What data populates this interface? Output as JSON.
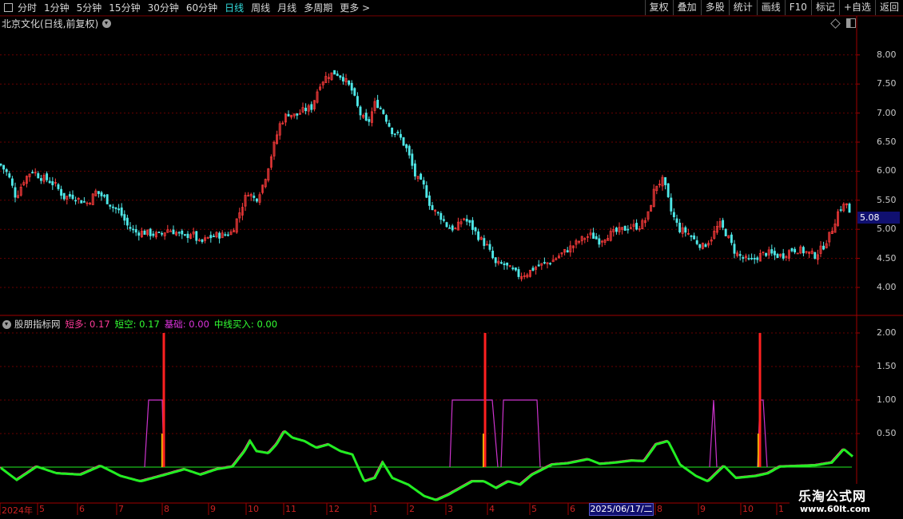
{
  "toolbar": {
    "periods": [
      "分时",
      "1分钟",
      "5分钟",
      "15分钟",
      "30分钟",
      "60分钟",
      "日线",
      "周线",
      "月线",
      "多周期"
    ],
    "active_period": "日线",
    "more": "更多 >",
    "right_buttons": [
      "复权",
      "叠加",
      "多股",
      "统计",
      "画线",
      "F10",
      "标记",
      "+自选",
      "返回"
    ]
  },
  "stock_title": "北京文化(日线,前复权)",
  "current_price": "5.08",
  "indicator": {
    "name": "股朋指标网",
    "items": [
      {
        "label": "短多: 0.17",
        "color": "#ff3b9a"
      },
      {
        "label": "短空: 0.17",
        "color": "#33ff33"
      },
      {
        "label": "基础: 0.00",
        "color": "#dd33dd"
      },
      {
        "label": "中线买入: 0.00",
        "color": "#33ff33"
      }
    ]
  },
  "colors": {
    "up": "#ff3c3c",
    "down": "#4fe8e8",
    "grid": "#6a0000",
    "axis": "#a00000",
    "green": "#22ee22",
    "magenta": "#cc33cc",
    "bar": "#ff2020"
  },
  "date_axis": {
    "labels": [
      {
        "text": "2024年",
        "x": 2
      },
      {
        "text": "5",
        "x": 49
      },
      {
        "text": "6",
        "x": 99
      },
      {
        "text": "7",
        "x": 148
      },
      {
        "text": "8",
        "x": 205
      },
      {
        "text": "9",
        "x": 263
      },
      {
        "text": "10",
        "x": 310
      },
      {
        "text": "11",
        "x": 357
      },
      {
        "text": "12",
        "x": 411
      },
      {
        "text": "1",
        "x": 466
      },
      {
        "text": "2",
        "x": 512
      },
      {
        "text": "3",
        "x": 560
      },
      {
        "text": "4",
        "x": 612
      },
      {
        "text": "5",
        "x": 665
      },
      {
        "text": "6",
        "x": 713
      },
      {
        "text": "8",
        "x": 822
      },
      {
        "text": "9",
        "x": 876
      },
      {
        "text": "10",
        "x": 929
      },
      {
        "text": "1",
        "x": 974
      }
    ],
    "highlight": "2025/06/17/二"
  },
  "chart_data": [
    {
      "type": "candlestick",
      "title": "北京文化(日线,前复权)",
      "y_ticks": [
        4.0,
        4.5,
        5.0,
        5.5,
        6.0,
        6.5,
        7.0,
        7.5,
        8.0
      ],
      "ylim": [
        3.7,
        8.5
      ],
      "close_path": [
        [
          0,
          6.12
        ],
        [
          10,
          5.95
        ],
        [
          20,
          5.55
        ],
        [
          30,
          5.85
        ],
        [
          40,
          6.02
        ],
        [
          50,
          5.9
        ],
        [
          60,
          5.85
        ],
        [
          70,
          5.75
        ],
        [
          80,
          5.55
        ],
        [
          90,
          5.58
        ],
        [
          100,
          5.5
        ],
        [
          110,
          5.45
        ],
        [
          120,
          5.65
        ],
        [
          130,
          5.55
        ],
        [
          140,
          5.4
        ],
        [
          150,
          5.3
        ],
        [
          160,
          5.05
        ],
        [
          170,
          4.95
        ],
        [
          180,
          4.95
        ],
        [
          190,
          4.92
        ],
        [
          200,
          4.9
        ],
        [
          210,
          5.0
        ],
        [
          220,
          4.95
        ],
        [
          230,
          4.85
        ],
        [
          240,
          4.95
        ],
        [
          250,
          4.75
        ],
        [
          260,
          4.85
        ],
        [
          270,
          4.9
        ],
        [
          280,
          4.9
        ],
        [
          290,
          4.95
        ],
        [
          300,
          5.3
        ],
        [
          310,
          5.65
        ],
        [
          320,
          5.5
        ],
        [
          330,
          5.8
        ],
        [
          340,
          6.3
        ],
        [
          350,
          6.8
        ],
        [
          360,
          7.0
        ],
        [
          370,
          6.95
        ],
        [
          380,
          7.05
        ],
        [
          390,
          7.1
        ],
        [
          400,
          7.5
        ],
        [
          410,
          7.65
        ],
        [
          420,
          7.7
        ],
        [
          430,
          7.6
        ],
        [
          440,
          7.4
        ],
        [
          450,
          7.0
        ],
        [
          460,
          6.8
        ],
        [
          470,
          7.2
        ],
        [
          480,
          7.0
        ],
        [
          490,
          6.7
        ],
        [
          500,
          6.6
        ],
        [
          510,
          6.35
        ],
        [
          520,
          5.9
        ],
        [
          530,
          5.75
        ],
        [
          540,
          5.35
        ],
        [
          550,
          5.25
        ],
        [
          560,
          5.05
        ],
        [
          570,
          5.0
        ],
        [
          580,
          5.2
        ],
        [
          590,
          5.05
        ],
        [
          600,
          4.85
        ],
        [
          610,
          4.7
        ],
        [
          620,
          4.4
        ],
        [
          630,
          4.4
        ],
        [
          640,
          4.3
        ],
        [
          650,
          4.2
        ],
        [
          660,
          4.25
        ],
        [
          670,
          4.35
        ],
        [
          680,
          4.4
        ],
        [
          690,
          4.45
        ],
        [
          700,
          4.55
        ],
        [
          710,
          4.65
        ],
        [
          720,
          4.75
        ],
        [
          730,
          4.85
        ],
        [
          740,
          4.9
        ],
        [
          750,
          4.8
        ],
        [
          760,
          4.9
        ],
        [
          770,
          4.95
        ],
        [
          780,
          5.0
        ],
        [
          790,
          5.05
        ],
        [
          800,
          5.05
        ],
        [
          810,
          5.2
        ],
        [
          820,
          5.75
        ],
        [
          830,
          5.85
        ],
        [
          840,
          5.3
        ],
        [
          850,
          5.0
        ],
        [
          860,
          4.95
        ],
        [
          870,
          4.8
        ],
        [
          880,
          4.7
        ],
        [
          890,
          4.85
        ],
        [
          900,
          5.1
        ],
        [
          910,
          4.9
        ],
        [
          920,
          4.6
        ],
        [
          930,
          4.5
        ],
        [
          940,
          4.45
        ],
        [
          950,
          4.55
        ],
        [
          960,
          4.6
        ],
        [
          970,
          4.55
        ],
        [
          980,
          4.55
        ],
        [
          990,
          4.65
        ],
        [
          1000,
          4.65
        ],
        [
          1010,
          4.6
        ],
        [
          1020,
          4.55
        ],
        [
          1030,
          4.7
        ],
        [
          1040,
          4.95
        ],
        [
          1050,
          5.35
        ],
        [
          1060,
          5.45
        ],
        [
          1066,
          5.08
        ]
      ]
    },
    {
      "type": "line",
      "title": "股朋指标网",
      "y_ticks": [
        0.5,
        1.0,
        1.5,
        2.0
      ],
      "ylim": [
        -0.5,
        2.2
      ],
      "series": [
        {
          "name": "短空",
          "values": [
            [
              0,
              0.0
            ],
            [
              20,
              -0.18
            ],
            [
              45,
              0.02
            ],
            [
              70,
              -0.08
            ],
            [
              100,
              -0.1
            ],
            [
              125,
              0.03
            ],
            [
              150,
              -0.12
            ],
            [
              175,
              -0.2
            ],
            [
              200,
              -0.12
            ],
            [
              230,
              -0.02
            ],
            [
              250,
              -0.1
            ],
            [
              270,
              -0.02
            ],
            [
              290,
              0.02
            ],
            [
              305,
              0.25
            ],
            [
              312,
              0.4
            ],
            [
              320,
              0.25
            ],
            [
              335,
              0.22
            ],
            [
              345,
              0.35
            ],
            [
              355,
              0.55
            ],
            [
              365,
              0.45
            ],
            [
              380,
              0.4
            ],
            [
              395,
              0.3
            ],
            [
              410,
              0.35
            ],
            [
              425,
              0.25
            ],
            [
              440,
              0.2
            ],
            [
              455,
              -0.2
            ],
            [
              468,
              -0.15
            ],
            [
              478,
              0.08
            ],
            [
              490,
              -0.15
            ],
            [
              510,
              -0.25
            ],
            [
              530,
              -0.42
            ],
            [
              545,
              -0.48
            ],
            [
              560,
              -0.4
            ],
            [
              575,
              -0.3
            ],
            [
              590,
              -0.2
            ],
            [
              605,
              -0.2
            ],
            [
              620,
              -0.3
            ],
            [
              635,
              -0.2
            ],
            [
              650,
              -0.25
            ],
            [
              665,
              -0.1
            ],
            [
              690,
              0.05
            ],
            [
              710,
              0.07
            ],
            [
              735,
              0.13
            ],
            [
              750,
              0.06
            ],
            [
              770,
              0.08
            ],
            [
              790,
              0.11
            ],
            [
              805,
              0.1
            ],
            [
              820,
              0.35
            ],
            [
              835,
              0.4
            ],
            [
              850,
              0.05
            ],
            [
              870,
              -0.12
            ],
            [
              885,
              -0.2
            ],
            [
              905,
              0.03
            ],
            [
              920,
              -0.15
            ],
            [
              945,
              -0.12
            ],
            [
              960,
              -0.08
            ],
            [
              975,
              0.02
            ],
            [
              1000,
              0.03
            ],
            [
              1020,
              0.04
            ],
            [
              1040,
              0.08
            ],
            [
              1055,
              0.28
            ],
            [
              1066,
              0.17
            ]
          ]
        },
        {
          "name": "中线买入",
          "values": [
            [
              0,
              0.0
            ],
            [
              1066,
              0.0
            ]
          ]
        }
      ]
    }
  ]
}
